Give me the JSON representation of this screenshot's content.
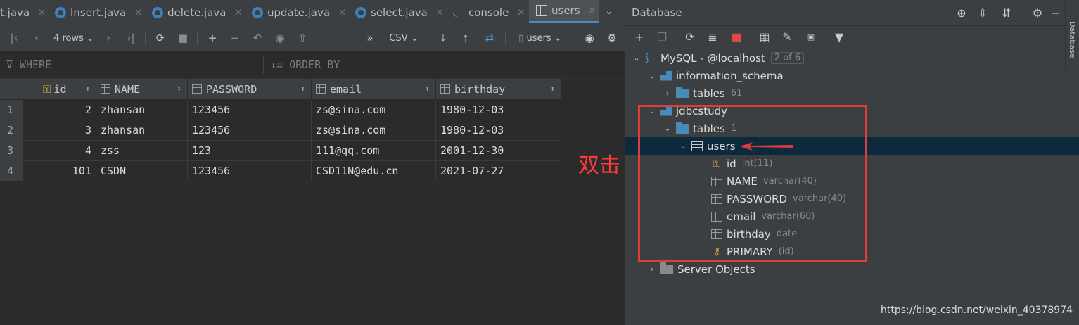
{
  "tabs": [
    {
      "label": "t.java"
    },
    {
      "label": "Insert.java"
    },
    {
      "label": "delete.java"
    },
    {
      "label": "update.java"
    },
    {
      "label": "select.java"
    },
    {
      "label": "console"
    },
    {
      "label": "users"
    }
  ],
  "toolbar": {
    "rows_label": "4 rows",
    "export_format": "CSV",
    "schema_selector": "users"
  },
  "filter": {
    "where_label": "WHERE",
    "orderby_label": "ORDER BY"
  },
  "grid": {
    "columns": [
      "id",
      "NAME",
      "PASSWORD",
      "email",
      "birthday"
    ],
    "rows": [
      {
        "rn": "1",
        "id": "2",
        "NAME": "zhansan",
        "PASSWORD": "123456",
        "email": "zs@sina.com",
        "birthday": "1980-12-03"
      },
      {
        "rn": "2",
        "id": "3",
        "NAME": "zhansan",
        "PASSWORD": "123456",
        "email": "zs@sina.com",
        "birthday": "1980-12-03"
      },
      {
        "rn": "3",
        "id": "4",
        "NAME": "zss",
        "PASSWORD": "123",
        "email": "111@qq.com",
        "birthday": "2001-12-30"
      },
      {
        "rn": "4",
        "id": "101",
        "NAME": "CSDN",
        "PASSWORD": "123456",
        "email": "CSD11N@edu.cn",
        "birthday": "2021-07-27"
      }
    ]
  },
  "database_panel": {
    "title": "Database",
    "side_tab": "Database",
    "tree": {
      "connection": {
        "label": "MySQL - @localhost",
        "badge": "2 of 6"
      },
      "schema1": {
        "label": "information_schema"
      },
      "schema1_tables": {
        "label": "tables",
        "count": "61"
      },
      "schema2": {
        "label": "jdbcstudy"
      },
      "schema2_tables": {
        "label": "tables",
        "count": "1"
      },
      "table": {
        "label": "users"
      },
      "columns": [
        {
          "label": "id",
          "type": "int(11)"
        },
        {
          "label": "NAME",
          "type": "varchar(40)"
        },
        {
          "label": "PASSWORD",
          "type": "varchar(40)"
        },
        {
          "label": "email",
          "type": "varchar(60)"
        },
        {
          "label": "birthday",
          "type": "date"
        }
      ],
      "key": {
        "label": "PRIMARY",
        "cols": "(id)"
      },
      "server_objects": {
        "label": "Server Objects"
      }
    }
  },
  "annotation": {
    "text": "双击"
  },
  "watermark": "https://blog.csdn.net/weixin_40378974",
  "colors": {
    "accent": "#4a88c7",
    "annotation": "#e03c3c",
    "selection": "#0d293e"
  }
}
